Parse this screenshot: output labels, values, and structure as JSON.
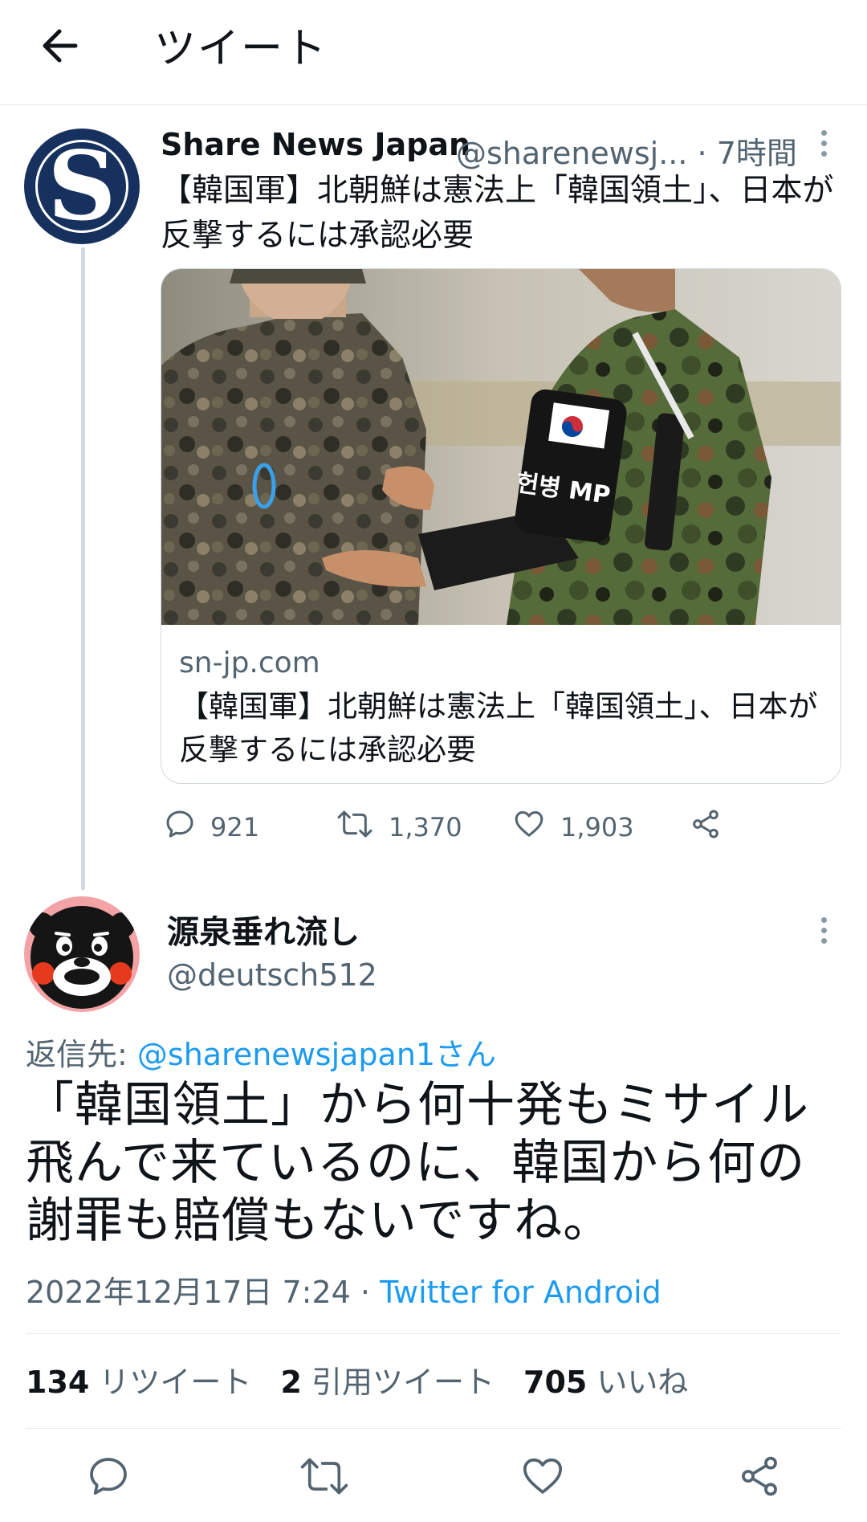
{
  "header": {
    "title": "ツイート"
  },
  "parent_tweet": {
    "name": "Share News Japan",
    "meta": "@sharenewsj... · 7時間",
    "text": "【韓国軍】北朝鮮は憲法上「韓国領土」、日本が反撃するには承認必要",
    "avatar_letter": "S",
    "card": {
      "domain": "sn-jp.com",
      "title": "【韓国軍】北朝鮮は憲法上「韓国領土」、日本が反撃するには承認必要",
      "armband_text": "헌병 MP"
    },
    "actions": {
      "replies": "921",
      "retweets": "1,370",
      "likes": "1,903"
    }
  },
  "main_tweet": {
    "name": "源泉垂れ流し",
    "handle": "@deutsch512",
    "reply_prefix": "返信先: ",
    "reply_mention": "@sharenewsjapan1さん",
    "text": "「韓国領土」から何十発もミサイル飛んで来ているのに、韓国から何の謝罪も賠償もないですね。",
    "timestamp": "2022年12月17日 7:24 · ",
    "client": "Twitter for Android",
    "stats": {
      "retweets_num": "134",
      "retweets_label": "リツイート",
      "quotes_num": "2",
      "quotes_label": "引用ツイート",
      "likes_num": "705",
      "likes_label": "いいね"
    }
  },
  "colors": {
    "link": "#1d9bf0",
    "secondary": "#536471",
    "avatar_bg": "#17315e"
  },
  "icons": [
    "back-arrow-icon",
    "more-icon",
    "reply-icon",
    "retweet-icon",
    "like-icon",
    "share-icon"
  ]
}
